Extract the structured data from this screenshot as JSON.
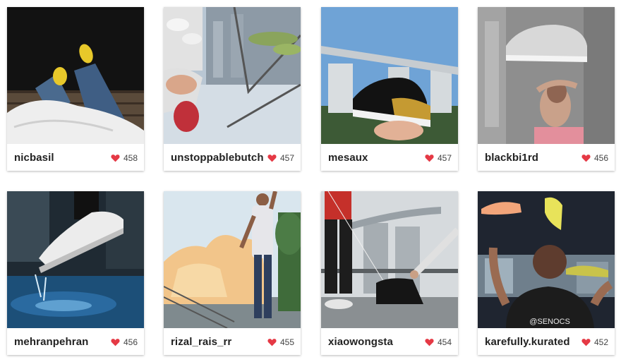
{
  "colors": {
    "heart": "#e53945",
    "username": "#222222",
    "count": "#444444"
  },
  "posts": [
    {
      "username": "nicbasil",
      "likes": "458",
      "photo": "legs-yellow-sneakers-photo"
    },
    {
      "username": "unstoppablebutch",
      "likes": "457",
      "photo": "reflection-railing-photo"
    },
    {
      "username": "mesaux",
      "likes": "457",
      "photo": "marina-bay-black-sneaker-photo"
    },
    {
      "username": "blackbi1rd",
      "likes": "456",
      "photo": "floating-grey-sneaker-photo"
    },
    {
      "username": "mehranpehran",
      "likes": "456",
      "photo": "white-sneaker-water-splash-photo"
    },
    {
      "username": "rizal_rais_rr",
      "likes": "455",
      "photo": "artscience-museum-man-photo"
    },
    {
      "username": "xiaowongsta",
      "likes": "454",
      "photo": "sneaker-pulled-by-string-photo"
    },
    {
      "username": "karefully.kurated",
      "likes": "452",
      "photo": "juggling-sneakers-senocs-photo"
    }
  ]
}
